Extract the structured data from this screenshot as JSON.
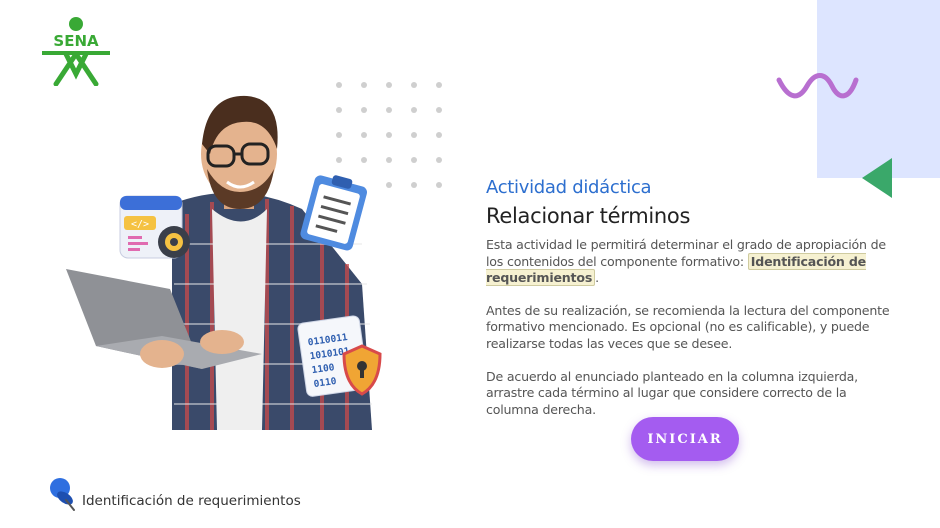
{
  "brand": {
    "logo_text": "SENA",
    "logo_color": "#39a935"
  },
  "activity": {
    "kicker": "Actividad didáctica",
    "title": "Relacionar términos",
    "p1_before": "Esta actividad le permitirá determinar el grado de apropiación de los contenidos del componente formativo: ",
    "p1_highlight": "Identificación de requerimientos",
    "p1_after": ".",
    "p2": "Antes de su realización, se recomienda la lectura del componente formativo mencionado.  Es opcional (no es calificable), y puede realizarse todas las veces que se desee.",
    "p3": "De acuerdo al enunciado planteado en la columna izquierda, arrastre cada término al lugar que considere correcto de la columna derecha."
  },
  "start_button": {
    "label": "INICIAR"
  },
  "footer": {
    "icon": "pushpin-icon",
    "label": "Identificación de requerimientos"
  },
  "decor": {
    "wave_color": "#b86fd0",
    "triangle_color": "#3aa86a",
    "panel_color": "#dde5ff",
    "accent": "#a45cf0"
  },
  "hero": {
    "badge_code": "</>",
    "binary_lines": [
      "0110011",
      "1010101",
      "1100",
      "0110"
    ]
  }
}
